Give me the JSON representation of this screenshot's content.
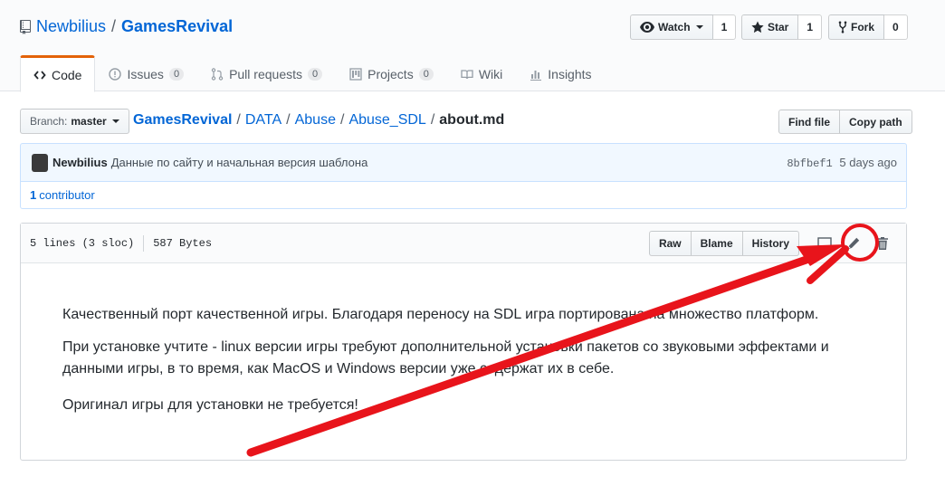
{
  "repo": {
    "owner": "Newbilius",
    "name": "GamesRevival",
    "separator": "/"
  },
  "actions": {
    "watch": {
      "label": "Watch",
      "count": "1"
    },
    "star": {
      "label": "Star",
      "count": "1"
    },
    "fork": {
      "label": "Fork",
      "count": "0"
    }
  },
  "tabs": [
    {
      "label": "Code",
      "counter": null,
      "selected": true
    },
    {
      "label": "Issues",
      "counter": "0"
    },
    {
      "label": "Pull requests",
      "counter": "0"
    },
    {
      "label": "Projects",
      "counter": "0"
    },
    {
      "label": "Wiki",
      "counter": null
    },
    {
      "label": "Insights",
      "counter": null
    }
  ],
  "branch": {
    "label": "Branch:",
    "value": "master"
  },
  "breadcrumb": {
    "parts": [
      "GamesRevival",
      "DATA",
      "Abuse",
      "Abuse_SDL"
    ],
    "separator": "/",
    "file": "about.md"
  },
  "file_nav": {
    "find_file": "Find file",
    "copy_path": "Copy path"
  },
  "commit": {
    "author": "Newbilius",
    "message": "Данные по сайту и начальная версия шаблона",
    "sha": "8bfbef1",
    "time": "5 days ago"
  },
  "contributors": {
    "count": "1",
    "label": "contributor"
  },
  "file": {
    "lines": "5 lines (3 sloc)",
    "size": "587 Bytes",
    "buttons": {
      "raw": "Raw",
      "blame": "Blame",
      "history": "History"
    },
    "icons": [
      "desktop-icon",
      "pencil-icon",
      "trash-icon"
    ]
  },
  "readme": {
    "p1": "Качественный порт качественной игры. Благодаря переносу на SDL игра портирована на множество платформ.",
    "p2": "При установке учтите - linux версии игры требуют дополнительной установки пакетов со звуковыми эффектами и данными игры, в то время, как MacOS и Windows версии уже содержат их в себе.",
    "p3": "Оригинал игры для установки не требуется!"
  },
  "annotation": {
    "color": "#e8141b",
    "target": "pencil-icon"
  },
  "colors": {
    "link": "#0366d6",
    "tab_accent": "#e36209",
    "commit_bg": "#f1f8ff"
  }
}
